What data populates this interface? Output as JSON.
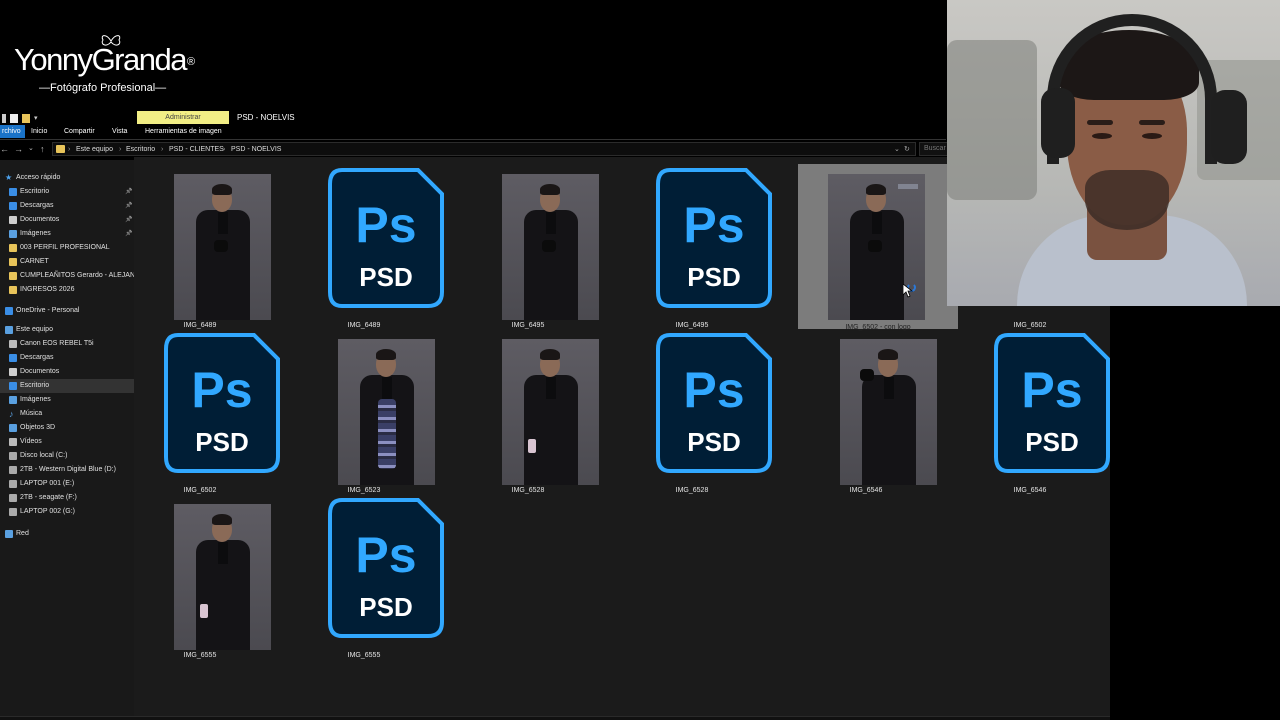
{
  "brand": {
    "name_bold": "Yonny",
    "name_light": "Granda",
    "registered": "®",
    "tagline": "—Fotógrafo Profesional—"
  },
  "ribbon": {
    "context_badge": "Administrar",
    "window_title": "PSD - NOELVIS",
    "tabs": [
      "rchivo",
      "Inicio",
      "Compartir",
      "Vista",
      "Herramientas de imagen"
    ]
  },
  "address": {
    "crumbs": [
      "Este equipo",
      "Escritorio",
      "PSD - CLIENTES",
      "PSD - NOELVIS"
    ],
    "search_placeholder": "Buscar"
  },
  "nav": {
    "items": [
      {
        "label": "Acceso rápido",
        "icon": "star-icon",
        "color": "#4da3f0",
        "indent": 1,
        "pinned": false,
        "selected": false
      },
      {
        "label": "Escritorio",
        "icon": "desktop-icon",
        "color": "#3a8ee6",
        "indent": 2,
        "pinned": true,
        "selected": false
      },
      {
        "label": "Descargas",
        "icon": "download-icon",
        "color": "#3a8ee6",
        "indent": 2,
        "pinned": true,
        "selected": false
      },
      {
        "label": "Documentos",
        "icon": "documents-icon",
        "color": "#cfcfcf",
        "indent": 2,
        "pinned": true,
        "selected": false
      },
      {
        "label": "Imágenes",
        "icon": "pictures-icon",
        "color": "#5aa0e0",
        "indent": 2,
        "pinned": true,
        "selected": false
      },
      {
        "label": "003 PERFIL PROFESIONAL",
        "icon": "folder-icon",
        "color": "#e8c45a",
        "indent": 2,
        "pinned": false,
        "selected": false
      },
      {
        "label": "CARNET",
        "icon": "folder-icon",
        "color": "#e8c45a",
        "indent": 2,
        "pinned": false,
        "selected": false
      },
      {
        "label": "CUMPLEAÑITOS Gerardo - ALEJANDRO",
        "icon": "folder-icon",
        "color": "#e8c45a",
        "indent": 2,
        "pinned": false,
        "selected": false
      },
      {
        "label": "INGRESOS 2026",
        "icon": "folder-icon",
        "color": "#e8c45a",
        "indent": 2,
        "pinned": false,
        "selected": false
      },
      {
        "label": "OneDrive - Personal",
        "icon": "cloud-icon",
        "color": "#3a8ee6",
        "indent": 1,
        "pinned": false,
        "selected": false
      },
      {
        "label": "Este equipo",
        "icon": "computer-icon",
        "color": "#5aa0e0",
        "indent": 1,
        "pinned": false,
        "selected": false
      },
      {
        "label": "Canon EOS REBEL T5i",
        "icon": "camera-icon",
        "color": "#bbbbbb",
        "indent": 2,
        "pinned": false,
        "selected": false
      },
      {
        "label": "Descargas",
        "icon": "download-icon",
        "color": "#3a8ee6",
        "indent": 2,
        "pinned": false,
        "selected": false
      },
      {
        "label": "Documentos",
        "icon": "documents-icon",
        "color": "#cfcfcf",
        "indent": 2,
        "pinned": false,
        "selected": false
      },
      {
        "label": "Escritorio",
        "icon": "desktop-icon",
        "color": "#3a8ee6",
        "indent": 2,
        "pinned": false,
        "selected": true
      },
      {
        "label": "Imágenes",
        "icon": "pictures-icon",
        "color": "#5aa0e0",
        "indent": 2,
        "pinned": false,
        "selected": false
      },
      {
        "label": "Música",
        "icon": "music-icon",
        "color": "#5aa0e0",
        "indent": 2,
        "pinned": false,
        "selected": false
      },
      {
        "label": "Objetos 3D",
        "icon": "cube-icon",
        "color": "#5aa0e0",
        "indent": 2,
        "pinned": false,
        "selected": false
      },
      {
        "label": "Vídeos",
        "icon": "video-icon",
        "color": "#bbbbbb",
        "indent": 2,
        "pinned": false,
        "selected": false
      },
      {
        "label": "Disco local (C:)",
        "icon": "drive-icon",
        "color": "#aaaaaa",
        "indent": 2,
        "pinned": false,
        "selected": false
      },
      {
        "label": "2TB - Western Digital Blue (D:)",
        "icon": "drive-icon",
        "color": "#aaaaaa",
        "indent": 2,
        "pinned": false,
        "selected": false
      },
      {
        "label": "LAPTOP 001 (E:)",
        "icon": "drive-icon",
        "color": "#aaaaaa",
        "indent": 2,
        "pinned": false,
        "selected": false
      },
      {
        "label": "2TB - seagate (F:)",
        "icon": "drive-icon",
        "color": "#aaaaaa",
        "indent": 2,
        "pinned": false,
        "selected": false
      },
      {
        "label": "LAPTOP 002 (G:)",
        "icon": "drive-icon",
        "color": "#aaaaaa",
        "indent": 2,
        "pinned": false,
        "selected": false
      },
      {
        "label": "Red",
        "icon": "network-icon",
        "color": "#5aa0e0",
        "indent": 1,
        "pinned": false,
        "selected": false
      }
    ]
  },
  "files": [
    {
      "name": "IMG_6489",
      "type": "jpg",
      "variant": "hands",
      "selected": false
    },
    {
      "name": "IMG_6489",
      "type": "psd",
      "selected": false
    },
    {
      "name": "IMG_6495",
      "type": "jpg",
      "variant": "hands",
      "selected": false
    },
    {
      "name": "IMG_6495",
      "type": "psd",
      "selected": false
    },
    {
      "name": "IMG_6502 - con logo",
      "type": "jpg",
      "variant": "logo",
      "selected": true
    },
    {
      "name": "IMG_6502",
      "type": "jpg",
      "variant": "hidden",
      "selected": false
    },
    {
      "name": "IMG_6502",
      "type": "psd",
      "selected": false
    },
    {
      "name": "IMG_6523",
      "type": "jpg",
      "variant": "medal",
      "selected": false
    },
    {
      "name": "IMG_6528",
      "type": "jpg",
      "variant": "object",
      "selected": false
    },
    {
      "name": "IMG_6528",
      "type": "psd",
      "selected": false
    },
    {
      "name": "IMG_6546",
      "type": "jpg",
      "variant": "wave",
      "selected": false
    },
    {
      "name": "IMG_6546",
      "type": "psd",
      "selected": false
    },
    {
      "name": "IMG_6555",
      "type": "jpg",
      "variant": "object",
      "selected": false
    },
    {
      "name": "IMG_6555",
      "type": "psd",
      "selected": false
    }
  ],
  "psd_icon": {
    "mark": "Ps",
    "caption": "PSD",
    "bg": "#001e36",
    "accent": "#31a8ff"
  },
  "colors": {
    "accent": "#1a73c8",
    "admin_badge": "#f2ee85",
    "folder": "#e8c45a"
  }
}
